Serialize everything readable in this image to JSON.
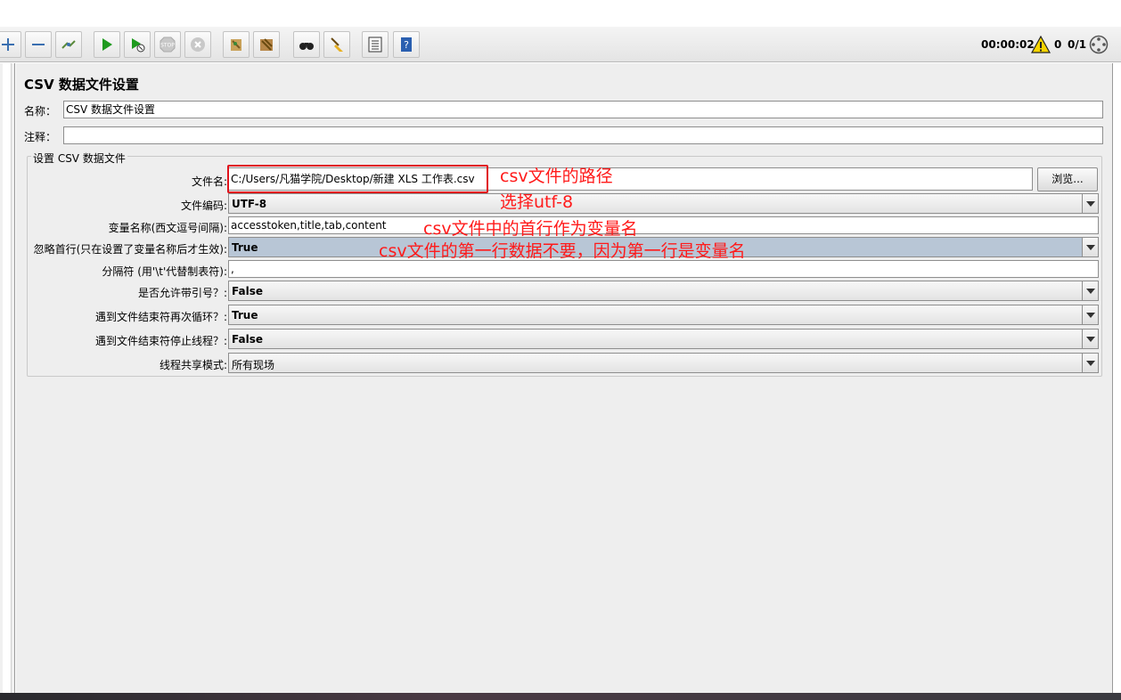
{
  "toolbar": {
    "timer": "00:00:02",
    "warning_count": "0",
    "threads": "0/1"
  },
  "panel": {
    "title": "CSV 数据文件设置",
    "name_label": "名称：",
    "name_value": "CSV 数据文件设置",
    "comment_label": "注释：",
    "comment_value": "",
    "group_title": "设置 CSV 数据文件",
    "filename_label": "文件名:",
    "filename_value": "C:/Users/凡猫学院/Desktop/新建 XLS 工作表.csv",
    "browse_label": "浏览...",
    "encoding_label": "文件编码:",
    "encoding_value": "UTF-8",
    "varnames_label": "变量名称(西文逗号间隔):",
    "varnames_value": "accesstoken,title,tab,content",
    "ignore_first_label": "忽略首行(只在设置了变量名称后才生效):",
    "ignore_first_value": "True",
    "delimiter_label": "分隔符 (用'\\t'代替制表符):",
    "delimiter_value": ",",
    "quoted_label": "是否允许带引号？:",
    "quoted_value": "False",
    "recycle_label": "遇到文件结束符再次循环？:",
    "recycle_value": "True",
    "stop_thread_label": "遇到文件结束符停止线程？:",
    "stop_thread_value": "False",
    "share_mode_label": "线程共享模式:",
    "share_mode_value": "所有现场"
  },
  "annotations": {
    "path": "csv文件的路径",
    "utf8": "选择utf-8",
    "header": "csv文件中的首行作为变量名",
    "skip_first": "csv文件的第一行数据不要，因为第一行是变量名"
  }
}
